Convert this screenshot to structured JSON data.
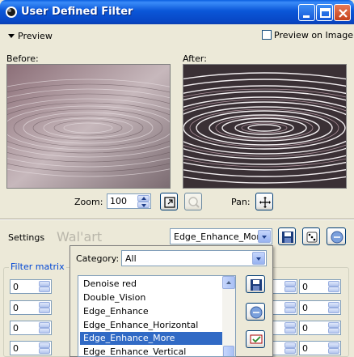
{
  "window": {
    "title": "User Defined Filter"
  },
  "preview": {
    "toggle_label": "Preview",
    "preview_on_image_label": "Preview on Image",
    "preview_on_image_checked": false,
    "before_label": "Before:",
    "after_label": "After:"
  },
  "zoom": {
    "label": "Zoom:",
    "value": "100",
    "pan_label": "Pan:"
  },
  "settings": {
    "label": "Settings",
    "watermark": "Wal'art",
    "preset_value": "Edge_Enhance_More"
  },
  "filter_matrix": {
    "title": "Filter matrix",
    "left_values": [
      "0",
      "0",
      "0",
      "0"
    ],
    "right_values": [
      "0",
      "0",
      "0",
      "0"
    ],
    "right2_values": [
      "0",
      "0",
      "0",
      "0"
    ]
  },
  "category_popup": {
    "category_label": "Category:",
    "category_value": "All",
    "items": [
      "Denoise red",
      "Double_Vision",
      "Edge_Enhance",
      "Edge_Enhance_Horizontal",
      "Edge_Enhance_More",
      "Edge_Enhance_Vertical"
    ],
    "selected_index": 4
  },
  "colors": {
    "title_blue": "#0a56d8",
    "selection_blue": "#316ac5",
    "face": "#ece9d8"
  }
}
